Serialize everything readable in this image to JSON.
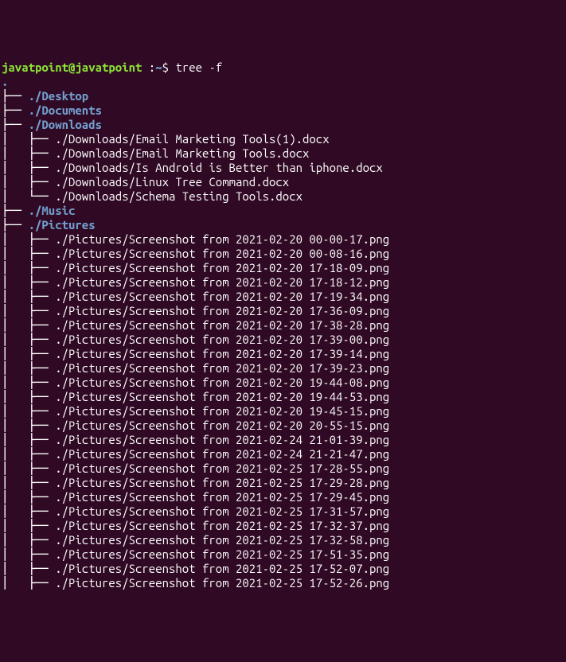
{
  "prompt": {
    "user_host": "javatpoint@javatpoint",
    "colon": " :",
    "path": "~",
    "suffix": "$ ",
    "command": "tree -f"
  },
  "root_dot": ".",
  "dirs": {
    "desktop": {
      "prefix": "├── ",
      "name": "./Desktop"
    },
    "documents": {
      "prefix": "├── ",
      "name": "./Documents"
    },
    "downloads": {
      "prefix": "├── ",
      "name": "./Downloads"
    },
    "music": {
      "prefix": "├── ",
      "name": "./Music"
    },
    "pictures": {
      "prefix": "├── ",
      "name": "./Pictures"
    }
  },
  "downloads_files": [
    {
      "prefix": "│   ├── ",
      "name": "./Downloads/Email Marketing Tools(1).docx"
    },
    {
      "prefix": "│   ├── ",
      "name": "./Downloads/Email Marketing Tools.docx"
    },
    {
      "prefix": "│   ├── ",
      "name": "./Downloads/Is Android is Better than iphone.docx"
    },
    {
      "prefix": "│   ├── ",
      "name": "./Downloads/Linux Tree Command.docx"
    },
    {
      "prefix": "│   └── ",
      "name": "./Downloads/Schema Testing Tools.docx"
    }
  ],
  "pictures_files": [
    {
      "prefix": "│   ├── ",
      "name": "./Pictures/Screenshot from 2021-02-20 00-00-17.png"
    },
    {
      "prefix": "│   ├── ",
      "name": "./Pictures/Screenshot from 2021-02-20 00-08-16.png"
    },
    {
      "prefix": "│   ├── ",
      "name": "./Pictures/Screenshot from 2021-02-20 17-18-09.png"
    },
    {
      "prefix": "│   ├── ",
      "name": "./Pictures/Screenshot from 2021-02-20 17-18-12.png"
    },
    {
      "prefix": "│   ├── ",
      "name": "./Pictures/Screenshot from 2021-02-20 17-19-34.png"
    },
    {
      "prefix": "│   ├── ",
      "name": "./Pictures/Screenshot from 2021-02-20 17-36-09.png"
    },
    {
      "prefix": "│   ├── ",
      "name": "./Pictures/Screenshot from 2021-02-20 17-38-28.png"
    },
    {
      "prefix": "│   ├── ",
      "name": "./Pictures/Screenshot from 2021-02-20 17-39-00.png"
    },
    {
      "prefix": "│   ├── ",
      "name": "./Pictures/Screenshot from 2021-02-20 17-39-14.png"
    },
    {
      "prefix": "│   ├── ",
      "name": "./Pictures/Screenshot from 2021-02-20 17-39-23.png"
    },
    {
      "prefix": "│   ├── ",
      "name": "./Pictures/Screenshot from 2021-02-20 19-44-08.png"
    },
    {
      "prefix": "│   ├── ",
      "name": "./Pictures/Screenshot from 2021-02-20 19-44-53.png"
    },
    {
      "prefix": "│   ├── ",
      "name": "./Pictures/Screenshot from 2021-02-20 19-45-15.png"
    },
    {
      "prefix": "│   ├── ",
      "name": "./Pictures/Screenshot from 2021-02-20 20-55-15.png"
    },
    {
      "prefix": "│   ├── ",
      "name": "./Pictures/Screenshot from 2021-02-24 21-01-39.png"
    },
    {
      "prefix": "│   ├── ",
      "name": "./Pictures/Screenshot from 2021-02-24 21-21-47.png"
    },
    {
      "prefix": "│   ├── ",
      "name": "./Pictures/Screenshot from 2021-02-25 17-28-55.png"
    },
    {
      "prefix": "│   ├── ",
      "name": "./Pictures/Screenshot from 2021-02-25 17-29-28.png"
    },
    {
      "prefix": "│   ├── ",
      "name": "./Pictures/Screenshot from 2021-02-25 17-29-45.png"
    },
    {
      "prefix": "│   ├── ",
      "name": "./Pictures/Screenshot from 2021-02-25 17-31-57.png"
    },
    {
      "prefix": "│   ├── ",
      "name": "./Pictures/Screenshot from 2021-02-25 17-32-37.png"
    },
    {
      "prefix": "│   ├── ",
      "name": "./Pictures/Screenshot from 2021-02-25 17-32-58.png"
    },
    {
      "prefix": "│   ├── ",
      "name": "./Pictures/Screenshot from 2021-02-25 17-51-35.png"
    },
    {
      "prefix": "│   ├── ",
      "name": "./Pictures/Screenshot from 2021-02-25 17-52-07.png"
    },
    {
      "prefix": "│   ├── ",
      "name": "./Pictures/Screenshot from 2021-02-25 17-52-26.png"
    }
  ]
}
